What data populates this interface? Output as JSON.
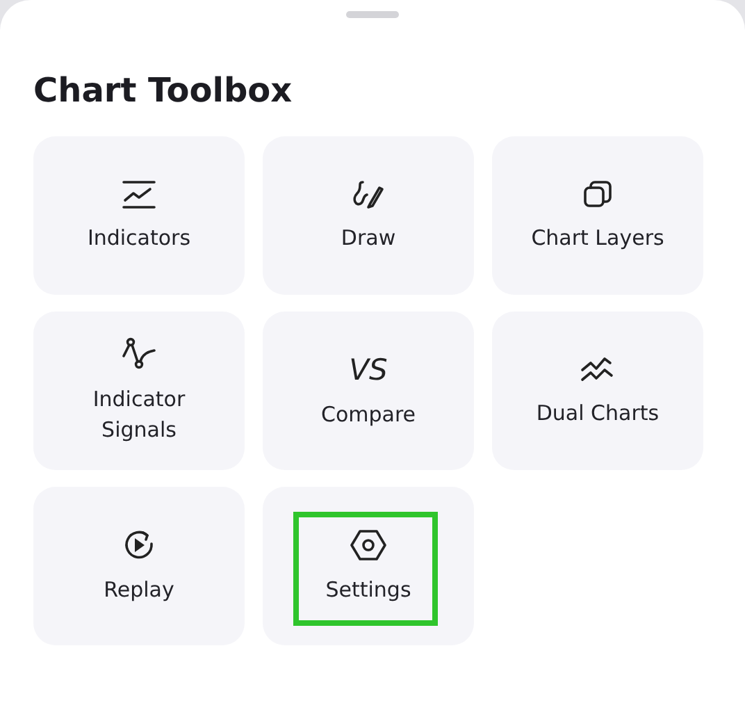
{
  "title": "Chart Toolbox",
  "tools": [
    {
      "label": "Indicators",
      "kind": "icon",
      "highlighted": false
    },
    {
      "label": "Draw",
      "kind": "icon",
      "highlighted": false
    },
    {
      "label": "Chart Layers",
      "kind": "icon",
      "highlighted": false
    },
    {
      "label": "Indicator Signals",
      "kind": "icon",
      "highlighted": false
    },
    {
      "label": "Compare",
      "kind": "text",
      "icon_text": "VS",
      "highlighted": false
    },
    {
      "label": "Dual Charts",
      "kind": "icon",
      "highlighted": false
    },
    {
      "label": "Replay",
      "kind": "icon",
      "highlighted": false
    },
    {
      "label": "Settings",
      "kind": "icon",
      "highlighted": true
    }
  ]
}
